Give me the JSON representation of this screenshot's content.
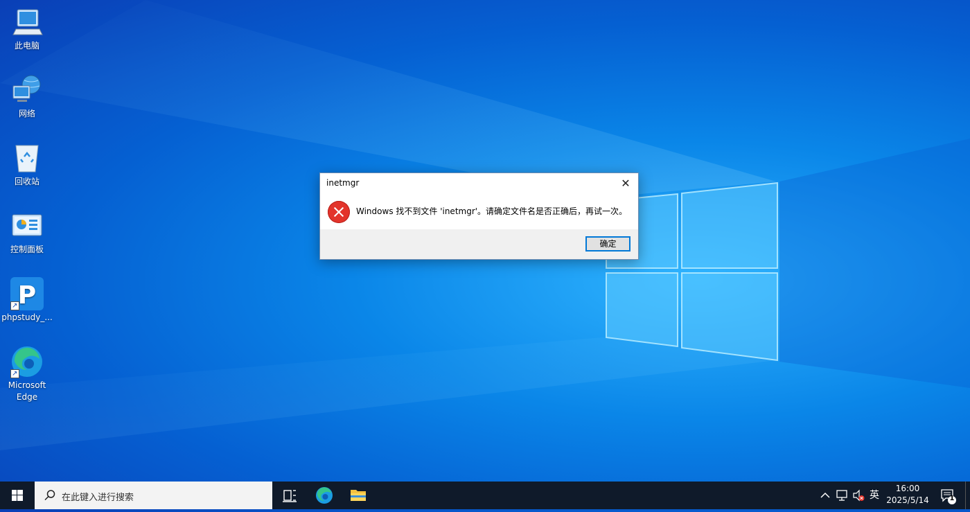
{
  "desktop": {
    "icons": [
      {
        "label": "此电脑",
        "icon": "computer-icon"
      },
      {
        "label": "网络",
        "icon": "network-icon"
      },
      {
        "label": "回收站",
        "icon": "recycle-bin-icon"
      },
      {
        "label": "控制面板",
        "icon": "control-panel-icon"
      },
      {
        "label": "phpstudy_...",
        "icon": "phpstudy-icon"
      },
      {
        "label": "Microsoft Edge",
        "icon": "edge-icon"
      }
    ]
  },
  "dialog": {
    "title": "inetmgr",
    "message": "Windows 找不到文件 'inetmgr'。请确定文件名是否正确后，再试一次。",
    "ok_label": "确定",
    "close_glyph": "✕"
  },
  "taskbar": {
    "search_placeholder": "在此键入进行搜索",
    "language": "英",
    "time": "16:00",
    "date": "2025/5/14",
    "notification_count": "1"
  },
  "colors": {
    "taskbar_bg": "#0f1a2a",
    "accent": "#0078d7",
    "error_red": "#e3342b"
  }
}
